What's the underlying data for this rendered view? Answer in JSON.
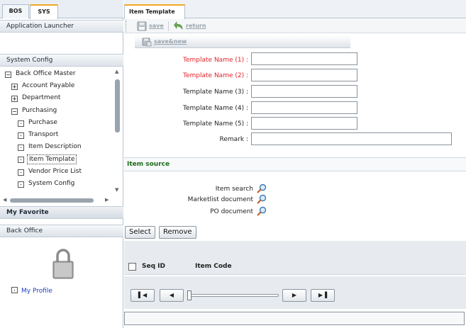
{
  "left_panel": {
    "tabs": [
      {
        "label": "BOS",
        "active": false
      },
      {
        "label": "SYS",
        "active": true
      }
    ],
    "app_launcher": "Application Launcher",
    "system_config_header": "System Config",
    "tree": [
      {
        "label": "Back Office Master",
        "expander": "minus",
        "level": 0
      },
      {
        "label": "Account Payable",
        "expander": "plus",
        "level": 1
      },
      {
        "label": "Department",
        "expander": "plus",
        "level": 1
      },
      {
        "label": "Purchasing",
        "expander": "minus",
        "level": 1
      },
      {
        "label": "Purchase",
        "expander": "leaf",
        "level": 2
      },
      {
        "label": "Transport",
        "expander": "leaf",
        "level": 2
      },
      {
        "label": "Item Description",
        "expander": "leaf",
        "level": 2
      },
      {
        "label": "Item Template",
        "expander": "leaf",
        "level": 2,
        "selected": true
      },
      {
        "label": "Vendor Price List",
        "expander": "leaf",
        "level": 2
      },
      {
        "label": "System Config",
        "expander": "leaf",
        "level": 2
      }
    ],
    "my_favorite": "My Favorite",
    "back_office": "Back Office",
    "my_profile": "My Profile",
    "lock_icon": "lock-icon"
  },
  "right_panel": {
    "tab_label": "Item Template",
    "toolbar": {
      "save_label": "save",
      "return_label": "return",
      "save_new_label": "save&new"
    },
    "form": {
      "fields": [
        {
          "label": "Template Name (1) :",
          "required": true,
          "value": ""
        },
        {
          "label": "Template Name (2) :",
          "required": true,
          "value": ""
        },
        {
          "label": "Template Name (3) :",
          "required": false,
          "value": ""
        },
        {
          "label": "Template Name (4) :",
          "required": false,
          "value": ""
        },
        {
          "label": "Template Name (5) :",
          "required": false,
          "value": ""
        }
      ],
      "remark_label": "Remark :",
      "remark_value": ""
    },
    "item_source": {
      "header": "Item source",
      "options": [
        "Item search",
        "Marketlist document",
        "PO document"
      ],
      "icon": "magnifier-icon"
    },
    "buttons": {
      "select": "Select",
      "remove": "Remove"
    },
    "grid": {
      "columns": [
        "Seq ID",
        "Item Code"
      ]
    },
    "pager": {
      "first": "first-page-icon",
      "prev": "prev-page-icon",
      "next": "next-page-icon",
      "last": "last-page-icon"
    }
  },
  "colors": {
    "tab_accent": "#f0a824",
    "required_label": "#e0242b",
    "section_title": "#1c6a1c",
    "link": "#1a3fc4"
  }
}
